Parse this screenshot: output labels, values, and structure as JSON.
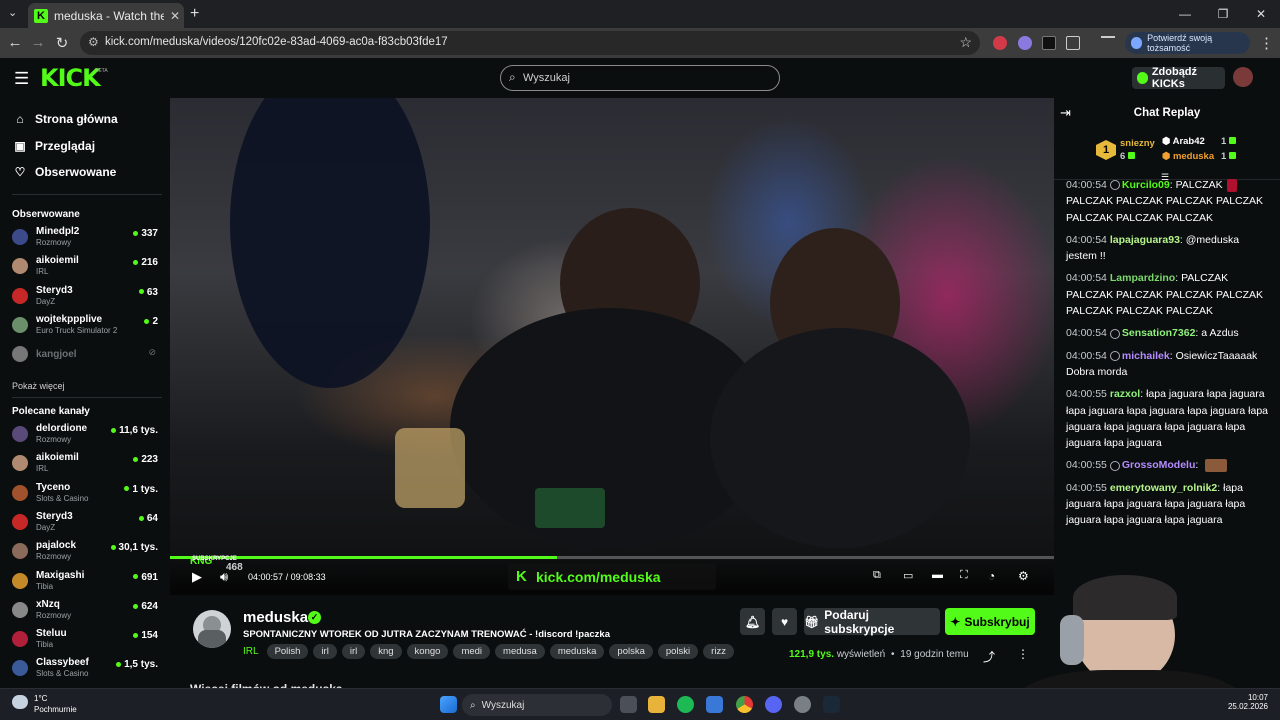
{
  "browser": {
    "tab_title": "meduska - Watch the VOD on Kick",
    "url": "kick.com/meduska/videos/120fc02e-83ad-4069-ac0a-f83cb03fde17",
    "verify_label": "Potwierdź swoją tożsamość"
  },
  "header": {
    "logo": "KICK",
    "beta": "BETA",
    "search_placeholder": "Wyszukaj",
    "kicks_label": "Zdobądź KICKs"
  },
  "sidebar": {
    "nav": [
      {
        "label": "Strona główna",
        "icon": "home-icon"
      },
      {
        "label": "Przeglądaj",
        "icon": "browse-icon"
      },
      {
        "label": "Obserwowane",
        "icon": "heart-icon"
      }
    ],
    "followed_heading": "Obserwowane",
    "followed": [
      {
        "name": "Minedpl2",
        "category": "Rozmowy",
        "viewers": "337",
        "color": "#3d4a8a"
      },
      {
        "name": "aikoiemil",
        "category": "IRL",
        "viewers": "216",
        "color": "#b08a70"
      },
      {
        "name": "Steryd3",
        "category": "DayZ",
        "viewers": "63",
        "color": "#c62828"
      },
      {
        "name": "wojtekppplive",
        "category": "Euro Truck Simulator 2",
        "viewers": "2",
        "color": "#6b8f6b"
      },
      {
        "name": "kangjoel",
        "category": "",
        "viewers": "",
        "color": "#777777"
      }
    ],
    "show_more": "Pokaż więcej",
    "recommended_heading": "Polecane kanały",
    "recommended": [
      {
        "name": "delordione",
        "category": "Rozmowy",
        "viewers": "11,6 tys.",
        "color": "#5a4a7a"
      },
      {
        "name": "aikoiemil",
        "category": "IRL",
        "viewers": "223",
        "color": "#b08a70"
      },
      {
        "name": "Tyceno",
        "category": "Slots & Casino",
        "viewers": "1 tys.",
        "color": "#a0522d"
      },
      {
        "name": "Steryd3",
        "category": "DayZ",
        "viewers": "64",
        "color": "#c62828"
      },
      {
        "name": "pajalock",
        "category": "Rozmowy",
        "viewers": "30,1 tys.",
        "color": "#8a6a5a"
      },
      {
        "name": "Maxigashi",
        "category": "Tibia",
        "viewers": "691",
        "color": "#c48a2a"
      },
      {
        "name": "xNzq",
        "category": "Rozmowy",
        "viewers": "624",
        "color": "#888888"
      },
      {
        "name": "Steluu",
        "category": "Tibia",
        "viewers": "154",
        "color": "#b0203a"
      },
      {
        "name": "Classybeef",
        "category": "Slots & Casino",
        "viewers": "1,5 tys.",
        "color": "#3a5a9a"
      }
    ]
  },
  "player": {
    "current_time": "04:00:57",
    "separator": "/",
    "duration": "09:08:33",
    "progress_fraction": 0.438,
    "overlay_url_prefix": "kick.com/",
    "overlay_url_user": "meduska",
    "sub_label": "SUBSKRYPCJE",
    "sub_count": "468",
    "watermark": "KNG"
  },
  "vod": {
    "streamer": "meduska",
    "title": "SPONTANICZNY WTOREK OD JUTRA ZACZYNAM TRENOWAĆ - !discord !paczka",
    "category": "IRL",
    "tags": [
      "Polish",
      "irl",
      "irl",
      "kng",
      "kongo",
      "medi",
      "medusa",
      "meduska",
      "polska",
      "polski",
      "rizz"
    ],
    "gift_label": "Podaruj subskrypcje",
    "subscribe_label": "Subskrybuj",
    "views": "121,9 tys.",
    "views_word": "wyświetleń",
    "bullet": "•",
    "age": "19 godzin temu",
    "more_videos": "Więcej filmów od meduska"
  },
  "chat": {
    "title": "Chat Replay",
    "leaders": [
      {
        "rank": "1",
        "name": "sniezny",
        "count": "6"
      },
      {
        "name": "Arab42",
        "count": "1"
      },
      {
        "name": "meduska",
        "count": "1"
      }
    ],
    "messages": [
      {
        "time": "04:00:54",
        "user": "Kurcilo09",
        "color": "#53fc18",
        "text": "PALCZAK",
        "emotes": "PALCZAK PALCZAK PALCZAK PALCZAK PALCZAK PALCZAK PALCZAK"
      },
      {
        "time": "04:00:54",
        "user": "lapajaguara93",
        "color": "#b6f58a",
        "text": "@meduska jestem !!"
      },
      {
        "time": "04:00:54",
        "user": "Lampardzino",
        "color": "#7bd96b",
        "text": "PALCZAK PALCZAK PALCZAK PALCZAK PALCZAK PALCZAK PALCZAK PALCZAK"
      },
      {
        "time": "04:00:54",
        "user": "Sensation7362",
        "color": "#8ef27a",
        "text": "a Azdus"
      },
      {
        "time": "04:00:54",
        "user": "michailek",
        "color": "#b48cff",
        "text": "OsiewiczTaaaaak Dobra morda"
      },
      {
        "time": "04:00:55",
        "user": "razxol",
        "color": "#8ef27a",
        "text": "łapa jaguara łapa jaguara łapa jaguara łapa jaguara łapa jaguara łapa jaguara łapa jaguara łapa jaguara łapa jaguara łapa jaguara"
      },
      {
        "time": "04:00:55",
        "user": "GrossoModelu",
        "color": "#b48cff",
        "text": ""
      },
      {
        "time": "04:00:55",
        "user": "emerytowany_rolnik2",
        "color": "#b6f58a",
        "text": "łapa jaguara łapa jaguara łapa jaguara łapa jaguara łapa jaguara łapa jaguara"
      }
    ]
  },
  "taskbar": {
    "temp": "1°C",
    "weather": "Pochmurnie",
    "search_placeholder": "Wyszukaj",
    "time": "10:07",
    "date": "25.02.2026"
  }
}
